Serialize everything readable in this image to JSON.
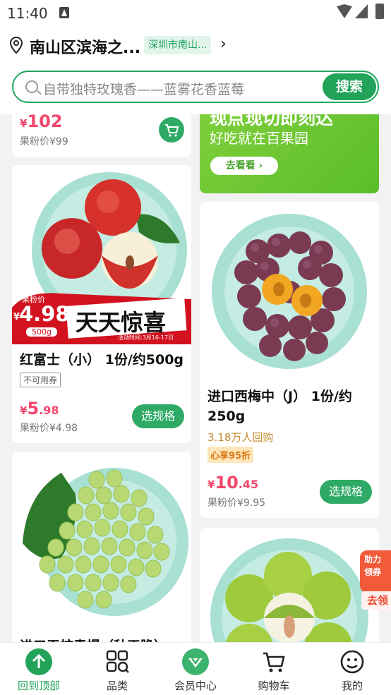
{
  "status_bar": {
    "time": "11:40"
  },
  "location": {
    "title": "南山区滨海之...",
    "badge": "深圳市南山...",
    "chevron": "›"
  },
  "search": {
    "placeholder": "自带独特玫瑰香——蓝雾花香蓝莓",
    "button": "搜索"
  },
  "banner": {
    "headline": "现点现切即刻达",
    "sub": "好吃就在百果园",
    "button": "去看看 ›"
  },
  "products": [
    {
      "id": "p0",
      "price_yen": "¥",
      "price_int": "102",
      "price_dec": "",
      "member": "果粉价¥99"
    },
    {
      "id": "p1",
      "title": "红富士（小） 1份/约500g",
      "tag": "不可用券",
      "price_yen": "¥",
      "price_int": "5",
      "price_dec": ".98",
      "member": "果粉价¥4.98",
      "button": "选规格",
      "promo": {
        "label": "果粉价",
        "price": "4.98",
        "yen": "¥",
        "unit": "500g",
        "slogan": "天天惊喜",
        "date": "活动时间:3月16-17日"
      }
    },
    {
      "id": "p2",
      "title": "进口西梅中（J） 1份/约250g",
      "popular": "3.18万人回购",
      "tag": "心享95折",
      "price_yen": "¥",
      "price_int": "10",
      "price_dec": ".45",
      "member": "果粉价¥9.95",
      "button": "选规格"
    },
    {
      "id": "p3",
      "title": "进口无核青提（秋天脆）"
    },
    {
      "id": "p4"
    }
  ],
  "float": {
    "text1": "助力",
    "text2": "领券",
    "text3": "去领"
  },
  "tabbar": [
    {
      "label": "回到顶部",
      "icon": "arrow-up-icon",
      "active": true
    },
    {
      "label": "品类",
      "icon": "category-icon"
    },
    {
      "label": "会员中心",
      "icon": "member-icon"
    },
    {
      "label": "购物车",
      "icon": "cart-icon"
    },
    {
      "label": "我的",
      "icon": "profile-icon"
    }
  ],
  "colors": {
    "brand": "#21a35a",
    "price": "#f2466c",
    "banner": "#6cc633"
  }
}
